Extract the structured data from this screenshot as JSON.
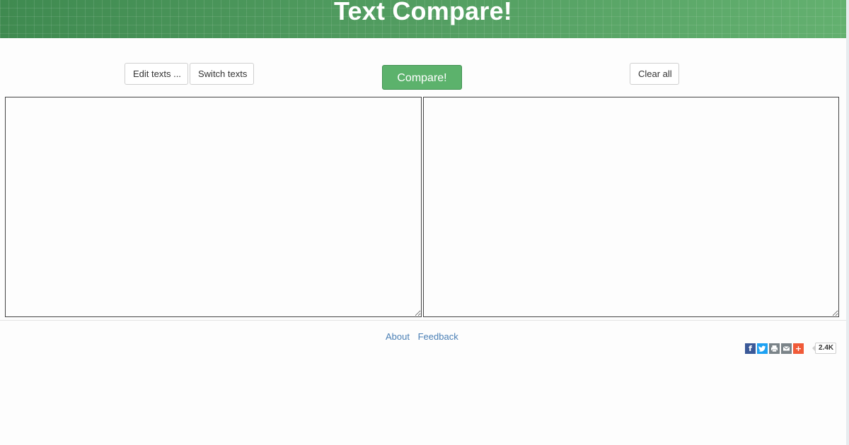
{
  "header": {
    "title": "Text Compare!"
  },
  "toolbar": {
    "edit_label": "Edit texts ...",
    "switch_label": "Switch texts",
    "compare_label": "Compare!",
    "clear_label": "Clear all"
  },
  "editors": {
    "left_value": "",
    "right_value": ""
  },
  "footer": {
    "about_label": "About",
    "feedback_label": "Feedback"
  },
  "share": {
    "icons": [
      "facebook-icon",
      "twitter-icon",
      "print-icon",
      "email-icon",
      "more-plus-icon"
    ],
    "count": "2.4K"
  },
  "colors": {
    "header_green": "#4f9a5e",
    "compare_green": "#5cb26c",
    "link_blue": "#4a7fb5",
    "facebook": "#3b5998",
    "twitter": "#1da1f2",
    "print": "#7a8388",
    "email": "#7a8388",
    "more": "#f05a38"
  }
}
